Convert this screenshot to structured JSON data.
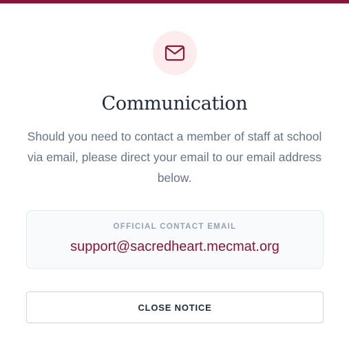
{
  "modal": {
    "title": "Communication",
    "body": "Should you need to contact a member of staff at school via email, please direct your email to our email address below.",
    "icon": "mail-icon",
    "contact": {
      "label": "OFFICIAL CONTACT EMAIL",
      "email": "support@sacredheart.mecmat.org"
    },
    "close_label": "CLOSE NOTICE"
  },
  "colors": {
    "accent": "#8a1538",
    "icon_bg": "#fdecee",
    "title": "#1e293b",
    "body_text": "#64748b",
    "label_text": "#94a3b8",
    "box_bg": "#f8fafc"
  }
}
